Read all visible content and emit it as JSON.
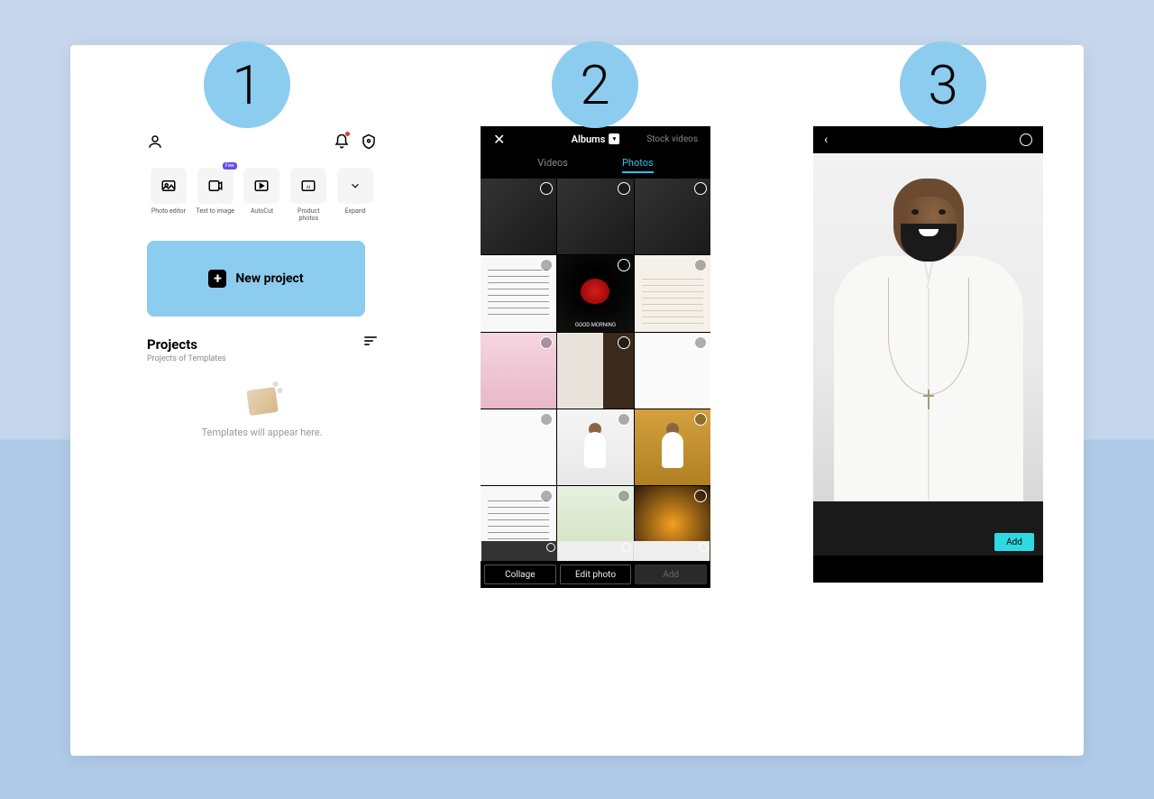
{
  "badges": [
    "1",
    "2",
    "3"
  ],
  "screen1": {
    "tools": [
      {
        "label": "Photo editor"
      },
      {
        "label": "Text to image",
        "tag": "Free"
      },
      {
        "label": "AutoCut"
      },
      {
        "label": "Product photos"
      },
      {
        "label": "Expand"
      }
    ],
    "new_project": "New project",
    "projects_title": "Projects",
    "projects_sub": "Projects of Templates",
    "empty_text": "Templates will appear here."
  },
  "screen2": {
    "albums": "Albums",
    "stock": "Stock videos",
    "tab_videos": "Videos",
    "tab_photos": "Photos",
    "good_morning": "GOOD MORNING",
    "collage": "Collage",
    "edit_photo": "Edit photo",
    "add": "Add"
  },
  "screen3": {
    "add": "Add"
  }
}
